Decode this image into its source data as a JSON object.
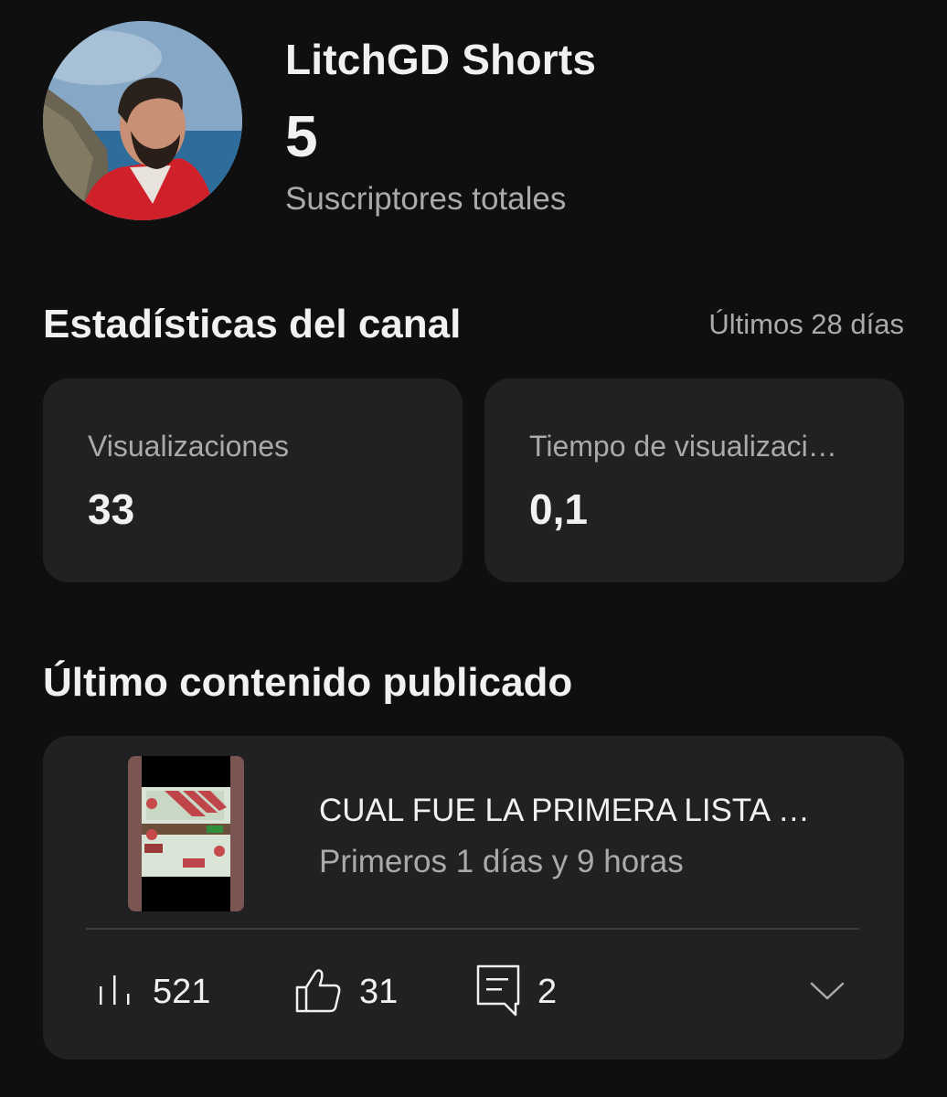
{
  "channel": {
    "name": "LitchGD Shorts",
    "subscriber_count": "5",
    "subscriber_label": "Suscriptores totales"
  },
  "stats": {
    "title": "Estadísticas del canal",
    "period": "Últimos 28 días",
    "cards": [
      {
        "label": "Visualizaciones",
        "value": "33"
      },
      {
        "label": "Tiempo de visualizaci…",
        "value": "0,1"
      }
    ]
  },
  "latest": {
    "title": "Último contenido publicado",
    "video": {
      "title": "CUAL FUE LA PRIMERA LISTA …",
      "subtitle": "Primeros 1 días y 9 horas",
      "views": "521",
      "likes": "31",
      "comments": "2"
    }
  },
  "icons": {
    "views": "bar-chart-icon",
    "likes": "thumbs-up-icon",
    "comments": "comment-icon",
    "expand": "chevron-down-icon"
  },
  "colors": {
    "background": "#0f0f0f",
    "card": "#212121",
    "text_primary": "#f1f1f1",
    "text_secondary": "#aaaaaa"
  }
}
